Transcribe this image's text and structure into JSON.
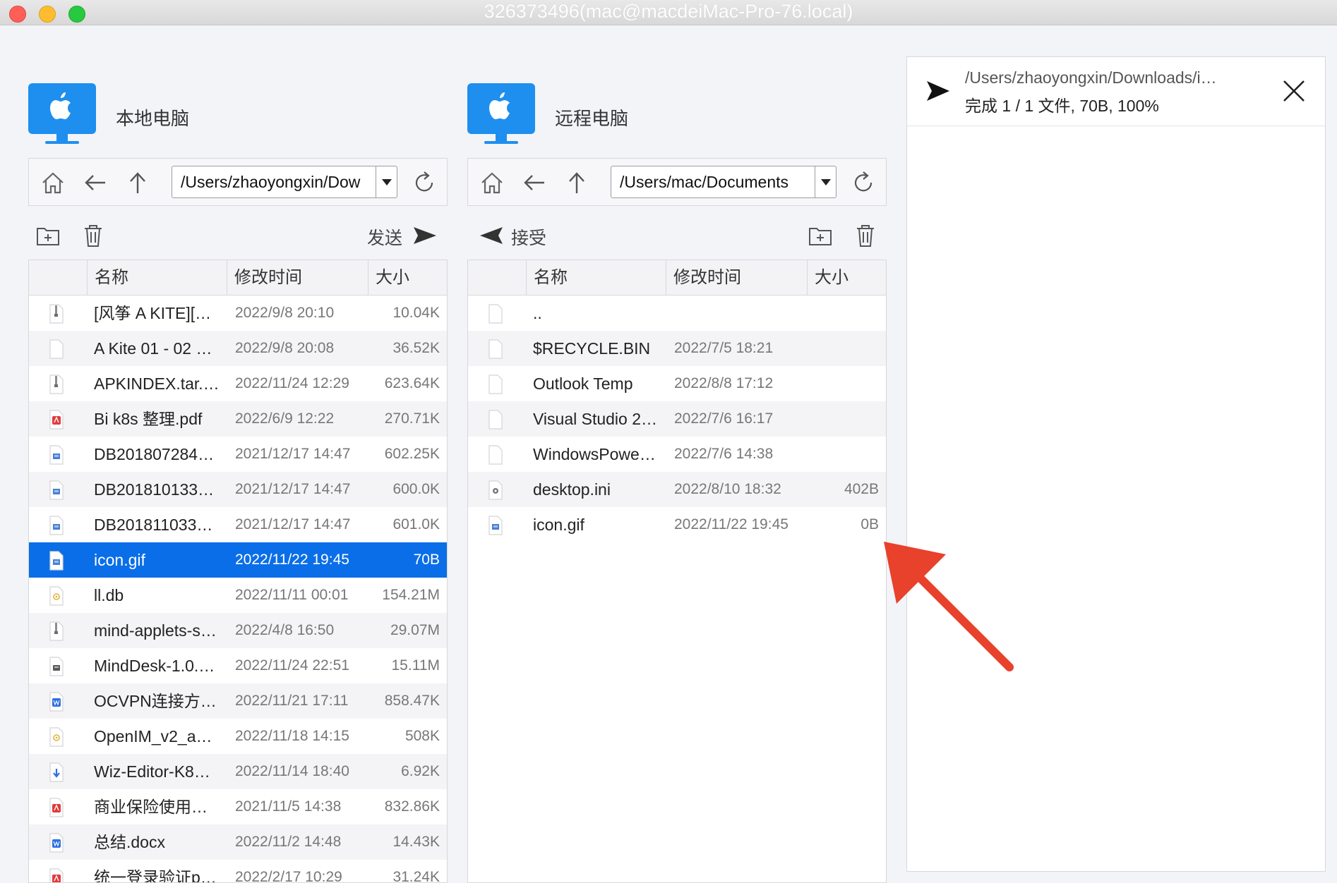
{
  "window": {
    "title": "326373496(mac@macdeiMac-Pro-76.local)"
  },
  "local": {
    "title": "本地电脑",
    "path": "/Users/zhaoyongxin/Dow",
    "send_label": "发送",
    "columns": [
      "名称",
      "修改时间",
      "大小"
    ],
    "files": [
      {
        "name": "[风筝 A KITE][…",
        "mtime": "2022/9/8 20:10",
        "size": "10.04K",
        "icon": "zip-icon"
      },
      {
        "name": "A Kite 01 - 02 …",
        "mtime": "2022/9/8 20:08",
        "size": "36.52K",
        "icon": "file-icon"
      },
      {
        "name": "APKINDEX.tar.…",
        "mtime": "2022/11/24 12:29",
        "size": "623.64K",
        "icon": "zip-icon"
      },
      {
        "name": "Bi k8s 整理.pdf",
        "mtime": "2022/6/9 12:22",
        "size": "270.71K",
        "icon": "pdf-icon"
      },
      {
        "name": "DB201807284…",
        "mtime": "2021/12/17 14:47",
        "size": "602.25K",
        "icon": "image-icon"
      },
      {
        "name": "DB201810133…",
        "mtime": "2021/12/17 14:47",
        "size": "600.0K",
        "icon": "image-icon"
      },
      {
        "name": "DB201811033…",
        "mtime": "2021/12/17 14:47",
        "size": "601.0K",
        "icon": "image-icon"
      },
      {
        "name": "icon.gif",
        "mtime": "2022/11/22 19:45",
        "size": "70B",
        "icon": "image-icon",
        "selected": true
      },
      {
        "name": "ll.db",
        "mtime": "2022/11/11 00:01",
        "size": "154.21M",
        "icon": "db-icon"
      },
      {
        "name": "mind-applets-s…",
        "mtime": "2022/4/8 16:50",
        "size": "29.07M",
        "icon": "zip-icon"
      },
      {
        "name": "MindDesk-1.0.…",
        "mtime": "2022/11/24 22:51",
        "size": "15.11M",
        "icon": "disk-icon"
      },
      {
        "name": "OCVPN连接方…",
        "mtime": "2022/11/21 17:11",
        "size": "858.47K",
        "icon": "word-icon"
      },
      {
        "name": "OpenIM_v2_a…",
        "mtime": "2022/11/18 14:15",
        "size": "508K",
        "icon": "db-icon"
      },
      {
        "name": "Wiz-Editor-K8…",
        "mtime": "2022/11/14 18:40",
        "size": "6.92K",
        "icon": "download-icon"
      },
      {
        "name": "商业保险使用…",
        "mtime": "2021/11/5 14:38",
        "size": "832.86K",
        "icon": "pdf-icon"
      },
      {
        "name": "总结.docx",
        "mtime": "2022/11/2 14:48",
        "size": "14.43K",
        "icon": "word-icon"
      },
      {
        "name": "统一登录验证p…",
        "mtime": "2022/2/17 10:29",
        "size": "31.24K",
        "icon": "pdf-icon"
      }
    ]
  },
  "remote": {
    "title": "远程电脑",
    "path": "/Users/mac/Documents",
    "receive_label": "接受",
    "columns": [
      "名称",
      "修改时间",
      "大小"
    ],
    "files": [
      {
        "name": "..",
        "mtime": "",
        "size": "",
        "icon": "file-icon"
      },
      {
        "name": "$RECYCLE.BIN",
        "mtime": "2022/7/5 18:21",
        "size": "",
        "icon": "file-icon"
      },
      {
        "name": "Outlook Temp",
        "mtime": "2022/8/8 17:12",
        "size": "",
        "icon": "file-icon"
      },
      {
        "name": "Visual Studio 2…",
        "mtime": "2022/7/6 16:17",
        "size": "",
        "icon": "file-icon"
      },
      {
        "name": "WindowsPowe…",
        "mtime": "2022/7/6 14:38",
        "size": "",
        "icon": "file-icon"
      },
      {
        "name": "desktop.ini",
        "mtime": "2022/8/10 18:32",
        "size": "402B",
        "icon": "settings-icon"
      },
      {
        "name": "icon.gif",
        "mtime": "2022/11/22 19:45",
        "size": "0B",
        "icon": "image-icon"
      }
    ]
  },
  "transfer": {
    "items": [
      {
        "path": "/Users/zhaoyongxin/Downloads/i…",
        "status": "完成 1 / 1 文件, 70B, 100%"
      }
    ]
  },
  "colors": {
    "accent": "#0a6ee8",
    "icon_blue": "#1e8fef",
    "annotation_arrow": "#e8412c"
  }
}
